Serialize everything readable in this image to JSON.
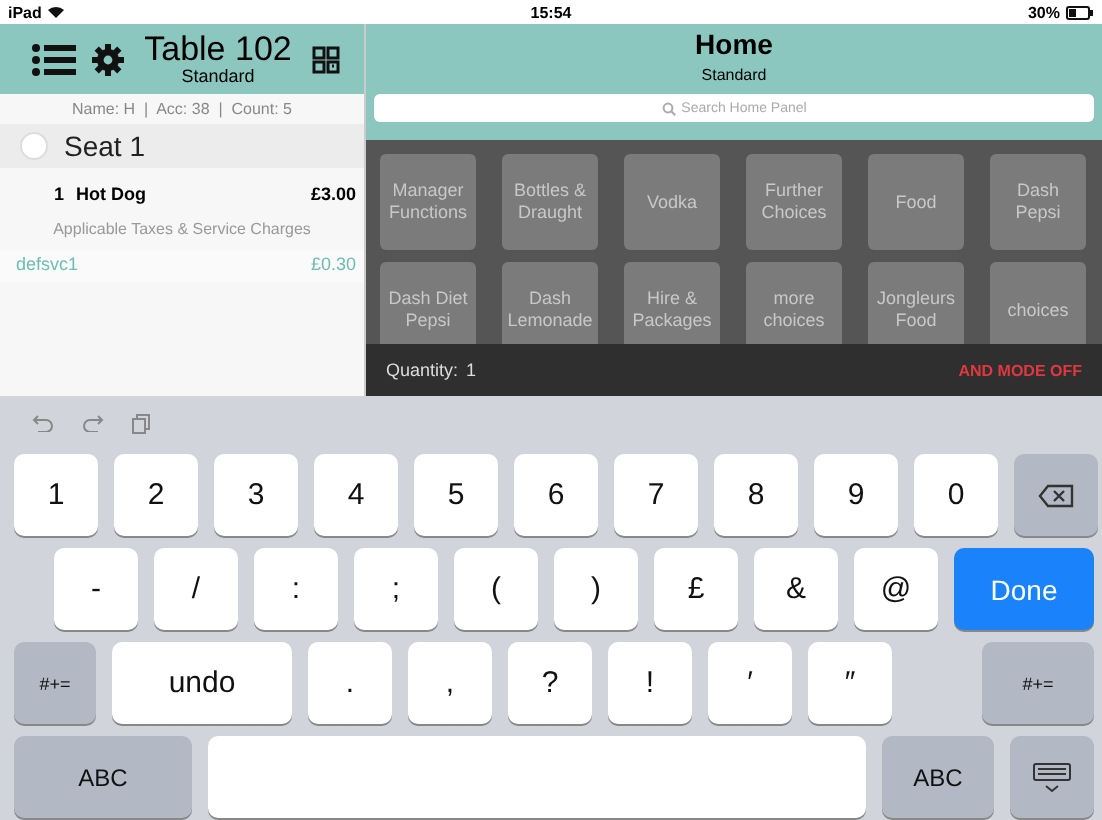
{
  "status_bar": {
    "device": "iPad",
    "time": "15:54",
    "battery": "30%"
  },
  "order_panel": {
    "title": "Table 102",
    "subtitle": "Standard",
    "info": "Name: H  |  Acc: 38  |  Count: 5",
    "seat": {
      "label": "Seat 1",
      "selected": false
    },
    "items": [
      {
        "qty": "1",
        "name": "Hot Dog",
        "price": "£3.00"
      }
    ],
    "taxes_heading": "Applicable Taxes & Service Charges",
    "charges": [
      {
        "name": "defsvc1",
        "price": "£0.30"
      }
    ]
  },
  "home_panel": {
    "title": "Home",
    "subtitle": "Standard",
    "search": {
      "placeholder": "Search Home Panel"
    },
    "buttons": [
      "Manager Functions",
      "Bottles & Draught",
      "Vodka",
      "Further Choices",
      "Food",
      "Dash Pepsi",
      "Dash Diet Pepsi",
      "Dash Lemonade",
      "Hire & Packages",
      "more choices",
      "Jongleurs Food",
      "choices"
    ],
    "quantity_label": "Quantity:",
    "quantity": "1",
    "and_mode": "AND MODE OFF"
  },
  "keyboard": {
    "rows": [
      [
        {
          "label": "1",
          "kind": "char"
        },
        {
          "label": "2",
          "kind": "char"
        },
        {
          "label": "3",
          "kind": "char"
        },
        {
          "label": "4",
          "kind": "char"
        },
        {
          "label": "5",
          "kind": "char"
        },
        {
          "label": "6",
          "kind": "char"
        },
        {
          "label": "7",
          "kind": "char"
        },
        {
          "label": "8",
          "kind": "char"
        },
        {
          "label": "9",
          "kind": "char"
        },
        {
          "label": "0",
          "kind": "char"
        },
        {
          "kind": "delete"
        }
      ],
      [
        {
          "label": "-",
          "kind": "char"
        },
        {
          "label": "/",
          "kind": "char"
        },
        {
          "label": ":",
          "kind": "char"
        },
        {
          "label": ";",
          "kind": "char"
        },
        {
          "label": "(",
          "kind": "char"
        },
        {
          "label": ")",
          "kind": "char"
        },
        {
          "label": "£",
          "kind": "char"
        },
        {
          "label": "&",
          "kind": "char"
        },
        {
          "label": "@",
          "kind": "char"
        },
        {
          "label": "Done",
          "kind": "primary"
        }
      ],
      [
        {
          "label": "#+=",
          "kind": "mod"
        },
        {
          "label": "undo",
          "kind": "char"
        },
        {
          "label": ".",
          "kind": "char"
        },
        {
          "label": ",",
          "kind": "char"
        },
        {
          "label": "?",
          "kind": "char"
        },
        {
          "label": "!",
          "kind": "char"
        },
        {
          "label": "′",
          "kind": "char"
        },
        {
          "label": "″",
          "kind": "char"
        },
        {
          "kind": "gap"
        },
        {
          "label": "#+=",
          "kind": "mod"
        }
      ],
      [
        {
          "label": "ABC",
          "kind": "mod"
        },
        {
          "kind": "space"
        },
        {
          "label": "ABC",
          "kind": "mod"
        },
        {
          "kind": "dismiss"
        }
      ]
    ]
  }
}
